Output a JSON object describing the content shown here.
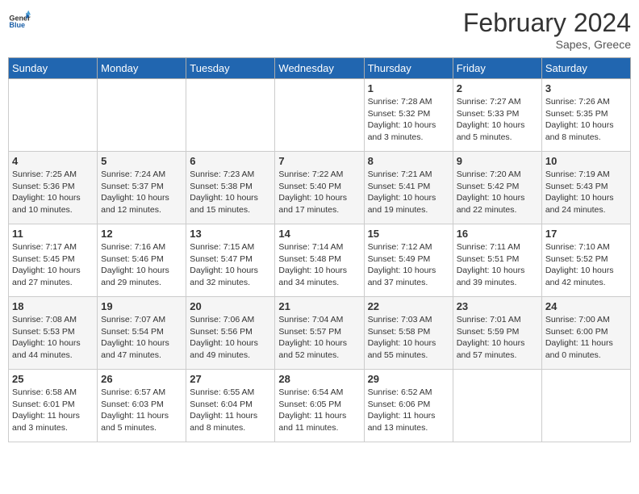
{
  "header": {
    "logo_general": "General",
    "logo_blue": "Blue",
    "month_year": "February 2024",
    "location": "Sapes, Greece"
  },
  "days_of_week": [
    "Sunday",
    "Monday",
    "Tuesday",
    "Wednesday",
    "Thursday",
    "Friday",
    "Saturday"
  ],
  "weeks": [
    [
      {
        "day": "",
        "info": ""
      },
      {
        "day": "",
        "info": ""
      },
      {
        "day": "",
        "info": ""
      },
      {
        "day": "",
        "info": ""
      },
      {
        "day": "1",
        "info": "Sunrise: 7:28 AM\nSunset: 5:32 PM\nDaylight: 10 hours\nand 3 minutes."
      },
      {
        "day": "2",
        "info": "Sunrise: 7:27 AM\nSunset: 5:33 PM\nDaylight: 10 hours\nand 5 minutes."
      },
      {
        "day": "3",
        "info": "Sunrise: 7:26 AM\nSunset: 5:35 PM\nDaylight: 10 hours\nand 8 minutes."
      }
    ],
    [
      {
        "day": "4",
        "info": "Sunrise: 7:25 AM\nSunset: 5:36 PM\nDaylight: 10 hours\nand 10 minutes."
      },
      {
        "day": "5",
        "info": "Sunrise: 7:24 AM\nSunset: 5:37 PM\nDaylight: 10 hours\nand 12 minutes."
      },
      {
        "day": "6",
        "info": "Sunrise: 7:23 AM\nSunset: 5:38 PM\nDaylight: 10 hours\nand 15 minutes."
      },
      {
        "day": "7",
        "info": "Sunrise: 7:22 AM\nSunset: 5:40 PM\nDaylight: 10 hours\nand 17 minutes."
      },
      {
        "day": "8",
        "info": "Sunrise: 7:21 AM\nSunset: 5:41 PM\nDaylight: 10 hours\nand 19 minutes."
      },
      {
        "day": "9",
        "info": "Sunrise: 7:20 AM\nSunset: 5:42 PM\nDaylight: 10 hours\nand 22 minutes."
      },
      {
        "day": "10",
        "info": "Sunrise: 7:19 AM\nSunset: 5:43 PM\nDaylight: 10 hours\nand 24 minutes."
      }
    ],
    [
      {
        "day": "11",
        "info": "Sunrise: 7:17 AM\nSunset: 5:45 PM\nDaylight: 10 hours\nand 27 minutes."
      },
      {
        "day": "12",
        "info": "Sunrise: 7:16 AM\nSunset: 5:46 PM\nDaylight: 10 hours\nand 29 minutes."
      },
      {
        "day": "13",
        "info": "Sunrise: 7:15 AM\nSunset: 5:47 PM\nDaylight: 10 hours\nand 32 minutes."
      },
      {
        "day": "14",
        "info": "Sunrise: 7:14 AM\nSunset: 5:48 PM\nDaylight: 10 hours\nand 34 minutes."
      },
      {
        "day": "15",
        "info": "Sunrise: 7:12 AM\nSunset: 5:49 PM\nDaylight: 10 hours\nand 37 minutes."
      },
      {
        "day": "16",
        "info": "Sunrise: 7:11 AM\nSunset: 5:51 PM\nDaylight: 10 hours\nand 39 minutes."
      },
      {
        "day": "17",
        "info": "Sunrise: 7:10 AM\nSunset: 5:52 PM\nDaylight: 10 hours\nand 42 minutes."
      }
    ],
    [
      {
        "day": "18",
        "info": "Sunrise: 7:08 AM\nSunset: 5:53 PM\nDaylight: 10 hours\nand 44 minutes."
      },
      {
        "day": "19",
        "info": "Sunrise: 7:07 AM\nSunset: 5:54 PM\nDaylight: 10 hours\nand 47 minutes."
      },
      {
        "day": "20",
        "info": "Sunrise: 7:06 AM\nSunset: 5:56 PM\nDaylight: 10 hours\nand 49 minutes."
      },
      {
        "day": "21",
        "info": "Sunrise: 7:04 AM\nSunset: 5:57 PM\nDaylight: 10 hours\nand 52 minutes."
      },
      {
        "day": "22",
        "info": "Sunrise: 7:03 AM\nSunset: 5:58 PM\nDaylight: 10 hours\nand 55 minutes."
      },
      {
        "day": "23",
        "info": "Sunrise: 7:01 AM\nSunset: 5:59 PM\nDaylight: 10 hours\nand 57 minutes."
      },
      {
        "day": "24",
        "info": "Sunrise: 7:00 AM\nSunset: 6:00 PM\nDaylight: 11 hours\nand 0 minutes."
      }
    ],
    [
      {
        "day": "25",
        "info": "Sunrise: 6:58 AM\nSunset: 6:01 PM\nDaylight: 11 hours\nand 3 minutes."
      },
      {
        "day": "26",
        "info": "Sunrise: 6:57 AM\nSunset: 6:03 PM\nDaylight: 11 hours\nand 5 minutes."
      },
      {
        "day": "27",
        "info": "Sunrise: 6:55 AM\nSunset: 6:04 PM\nDaylight: 11 hours\nand 8 minutes."
      },
      {
        "day": "28",
        "info": "Sunrise: 6:54 AM\nSunset: 6:05 PM\nDaylight: 11 hours\nand 11 minutes."
      },
      {
        "day": "29",
        "info": "Sunrise: 6:52 AM\nSunset: 6:06 PM\nDaylight: 11 hours\nand 13 minutes."
      },
      {
        "day": "",
        "info": ""
      },
      {
        "day": "",
        "info": ""
      }
    ]
  ]
}
